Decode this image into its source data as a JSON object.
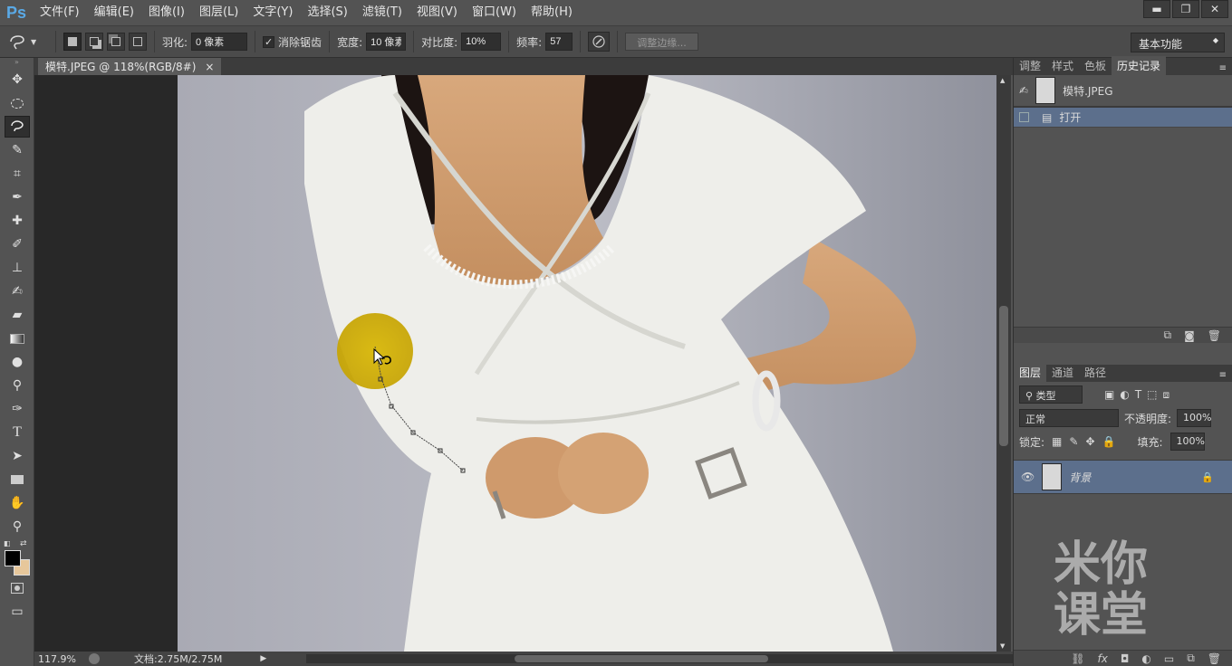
{
  "app": {
    "logo": "Ps"
  },
  "menu": [
    "文件(F)",
    "编辑(E)",
    "图像(I)",
    "图层(L)",
    "文字(Y)",
    "选择(S)",
    "滤镜(T)",
    "视图(V)",
    "窗口(W)",
    "帮助(H)"
  ],
  "window_buttons": {
    "minimize": "▬",
    "restore": "❐",
    "close": "✕"
  },
  "options": {
    "feather_label": "羽化:",
    "feather_value": "0 像素",
    "antialias_label": "消除锯齿",
    "antialias_checked": "✓",
    "width_label": "宽度:",
    "width_value": "10 像素",
    "contrast_label": "对比度:",
    "contrast_value": "10%",
    "frequency_label": "频率:",
    "frequency_value": "57",
    "refine_edge": "调整边缘...",
    "workspace": "基本功能"
  },
  "document": {
    "tab_title": "模特.JPEG @ 118%(RGB/8#)",
    "tab_close": "×"
  },
  "status": {
    "zoom": "117.9%",
    "doc_size": "文档:2.75M/2.75M"
  },
  "history_panel": {
    "tabs": [
      "调整",
      "样式",
      "色板",
      "历史记录"
    ],
    "snapshot": "模特.JPEG",
    "states": [
      "打开"
    ]
  },
  "layers_panel": {
    "tabs": [
      "图层",
      "通道",
      "路径"
    ],
    "filter_label": "类型",
    "blend_mode": "正常",
    "opacity_label": "不透明度:",
    "opacity_value": "100%",
    "lock_label": "锁定:",
    "fill_label": "填充:",
    "fill_value": "100%",
    "layers": [
      {
        "name": "背景"
      }
    ]
  },
  "watermark": [
    "米你",
    "课堂"
  ],
  "colors": {
    "accent_selected": "#5c6f8c",
    "foreground": "#000000",
    "background": "#e7c79b"
  }
}
